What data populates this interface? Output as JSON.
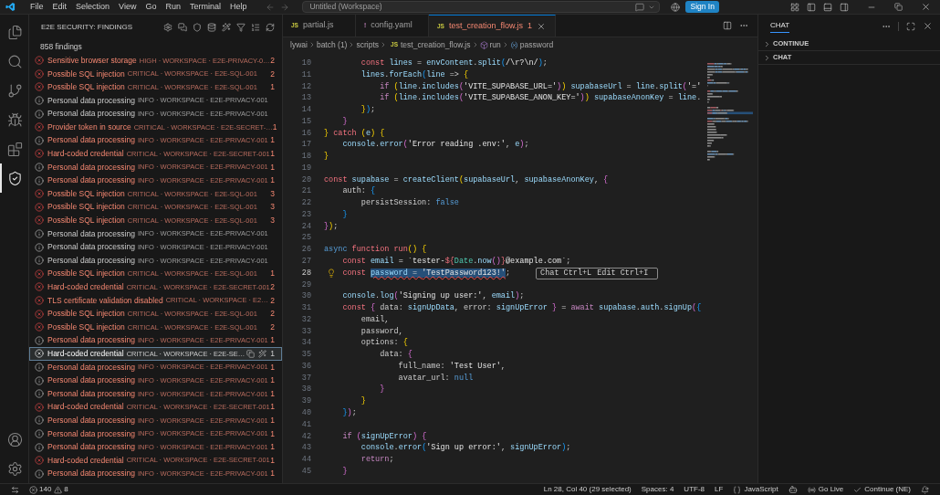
{
  "title_bar": {
    "menu": [
      "File",
      "Edit",
      "Selection",
      "View",
      "Go",
      "Run",
      "Terminal",
      "Help"
    ],
    "command_center": "Untitled (Workspace)",
    "sign_in": "Sign In"
  },
  "activity_bar": {
    "items": [
      {
        "kind": "files",
        "selected": false
      },
      {
        "kind": "search",
        "selected": false
      },
      {
        "kind": "branch",
        "selected": false
      },
      {
        "kind": "debug",
        "selected": false
      },
      {
        "kind": "extensions",
        "selected": false
      },
      {
        "kind": "security",
        "selected": true
      }
    ],
    "bottom_items": [
      {
        "kind": "account"
      },
      {
        "kind": "settings"
      }
    ]
  },
  "sidebar": {
    "title": "E2E SECURITY: FINDINGS",
    "summary": "858 findings",
    "findings": [
      {
        "kind": "error",
        "highlighted": true,
        "selected": false,
        "title": "Sensitive browser storage",
        "detail": "HIGH · WORKSPACE · E2E-PRIVACY-0…",
        "count": "2"
      },
      {
        "kind": "error",
        "highlighted": true,
        "selected": false,
        "title": "Possible SQL injection",
        "detail": "CRITICAL · WORKSPACE · E2E-SQL-001",
        "count": "2"
      },
      {
        "kind": "error",
        "highlighted": true,
        "selected": false,
        "title": "Possible SQL injection",
        "detail": "CRITICAL · WORKSPACE · E2E-SQL-001",
        "count": "1"
      },
      {
        "kind": "info",
        "highlighted": false,
        "selected": false,
        "title": "Personal data processing",
        "detail": "INFO · WORKSPACE · E2E-PRIVACY-001"
      },
      {
        "kind": "info",
        "highlighted": false,
        "selected": false,
        "title": "Personal data processing",
        "detail": "INFO · WORKSPACE · E2E-PRIVACY-001"
      },
      {
        "kind": "error",
        "highlighted": true,
        "selected": false,
        "title": "Provider token in source",
        "detail": "CRITICAL · WORKSPACE · E2E-SECRET-…",
        "count": "1"
      },
      {
        "kind": "info",
        "highlighted": true,
        "selected": false,
        "title": "Personal data processing",
        "detail": "INFO · WORKSPACE · E2E-PRIVACY-001",
        "count": "1"
      },
      {
        "kind": "error",
        "highlighted": true,
        "selected": false,
        "title": "Hard-coded credential",
        "detail": "CRITICAL · WORKSPACE · E2E-SECRET-001",
        "count": "1"
      },
      {
        "kind": "info",
        "highlighted": true,
        "selected": false,
        "title": "Personal data processing",
        "detail": "INFO · WORKSPACE · E2E-PRIVACY-001",
        "count": "1"
      },
      {
        "kind": "info",
        "highlighted": true,
        "selected": false,
        "title": "Personal data processing",
        "detail": "INFO · WORKSPACE · E2E-PRIVACY-001",
        "count": "1"
      },
      {
        "kind": "error",
        "highlighted": true,
        "selected": false,
        "title": "Possible SQL injection",
        "detail": "CRITICAL · WORKSPACE · E2E-SQL-001",
        "count": "3"
      },
      {
        "kind": "error",
        "highlighted": true,
        "selected": false,
        "title": "Possible SQL injection",
        "detail": "CRITICAL · WORKSPACE · E2E-SQL-001",
        "count": "3"
      },
      {
        "kind": "error",
        "highlighted": true,
        "selected": false,
        "title": "Possible SQL injection",
        "detail": "CRITICAL · WORKSPACE · E2E-SQL-001",
        "count": "3"
      },
      {
        "kind": "info",
        "highlighted": false,
        "selected": false,
        "title": "Personal data processing",
        "detail": "INFO · WORKSPACE · E2E-PRIVACY-001"
      },
      {
        "kind": "info",
        "highlighted": false,
        "selected": false,
        "title": "Personal data processing",
        "detail": "INFO · WORKSPACE · E2E-PRIVACY-001"
      },
      {
        "kind": "info",
        "highlighted": false,
        "selected": false,
        "title": "Personal data processing",
        "detail": "INFO · WORKSPACE · E2E-PRIVACY-001"
      },
      {
        "kind": "error",
        "highlighted": true,
        "selected": false,
        "title": "Possible SQL injection",
        "detail": "CRITICAL · WORKSPACE · E2E-SQL-001",
        "count": "1"
      },
      {
        "kind": "error",
        "highlighted": true,
        "selected": false,
        "title": "Hard-coded credential",
        "detail": "CRITICAL · WORKSPACE · E2E-SECRET-001",
        "count": "2"
      },
      {
        "kind": "error",
        "highlighted": true,
        "selected": false,
        "title": "TLS certificate validation disabled",
        "detail": "CRITICAL · WORKSPACE · E2…",
        "count": "2"
      },
      {
        "kind": "error",
        "highlighted": true,
        "selected": false,
        "title": "Possible SQL injection",
        "detail": "CRITICAL · WORKSPACE · E2E-SQL-001",
        "count": "2"
      },
      {
        "kind": "error",
        "highlighted": true,
        "selected": false,
        "title": "Possible SQL injection",
        "detail": "CRITICAL · WORKSPACE · E2E-SQL-001",
        "count": "2"
      },
      {
        "kind": "info",
        "highlighted": true,
        "selected": false,
        "title": "Personal data processing",
        "detail": "INFO · WORKSPACE · E2E-PRIVACY-001",
        "count": "1"
      },
      {
        "kind": "error",
        "highlighted": true,
        "selected": true,
        "title": "Hard-coded credential",
        "detail": "CRITICAL · WORKSPACE · E2E-SE…",
        "count": "1"
      },
      {
        "kind": "info",
        "highlighted": true,
        "selected": false,
        "title": "Personal data processing",
        "detail": "INFO · WORKSPACE · E2E-PRIVACY-001",
        "count": "1"
      },
      {
        "kind": "info",
        "highlighted": true,
        "selected": false,
        "title": "Personal data processing",
        "detail": "INFO · WORKSPACE · E2E-PRIVACY-001",
        "count": "1"
      },
      {
        "kind": "info",
        "highlighted": true,
        "selected": false,
        "title": "Personal data processing",
        "detail": "INFO · WORKSPACE · E2E-PRIVACY-001",
        "count": "1"
      },
      {
        "kind": "error",
        "highlighted": true,
        "selected": false,
        "title": "Hard-coded credential",
        "detail": "CRITICAL · WORKSPACE · E2E-SECRET-001",
        "count": "1"
      },
      {
        "kind": "info",
        "highlighted": true,
        "selected": false,
        "title": "Personal data processing",
        "detail": "INFO · WORKSPACE · E2E-PRIVACY-001",
        "count": "1"
      },
      {
        "kind": "info",
        "highlighted": true,
        "selected": false,
        "title": "Personal data processing",
        "detail": "INFO · WORKSPACE · E2E-PRIVACY-001",
        "count": "1"
      },
      {
        "kind": "info",
        "highlighted": true,
        "selected": false,
        "title": "Personal data processing",
        "detail": "INFO · WORKSPACE · E2E-PRIVACY-001",
        "count": "1"
      },
      {
        "kind": "error",
        "highlighted": true,
        "selected": false,
        "title": "Hard-coded credential",
        "detail": "CRITICAL · WORKSPACE · E2E-SECRET-001",
        "count": "1"
      },
      {
        "kind": "info",
        "highlighted": true,
        "selected": false,
        "title": "Personal data processing",
        "detail": "INFO · WORKSPACE · E2E-PRIVACY-001",
        "count": "1"
      }
    ]
  },
  "editor": {
    "tabs": [
      {
        "kind": "js",
        "icon": "JS",
        "label": "partial.js",
        "selected": false
      },
      {
        "kind": "yaml",
        "icon": "!",
        "label": "config.yaml",
        "selected": false
      },
      {
        "kind": "js",
        "icon": "JS",
        "label": "test_creation_flow.js",
        "badge": "1",
        "selected": true
      }
    ],
    "breadcrumbs": [
      {
        "kind": "folder",
        "label": "lywai"
      },
      {
        "kind": "folder",
        "label": "batch (1)"
      },
      {
        "kind": "folder",
        "label": "scripts"
      },
      {
        "kind": "js",
        "icon": "JS",
        "label": "test_creation_flow.js"
      },
      {
        "kind": "function",
        "label": "run"
      },
      {
        "kind": "variable",
        "label": "password"
      }
    ],
    "lines": [
      {
        "number": "10",
        "current": false,
        "tokens": [
          {
            "text": "        const ",
            "kind": "kw"
          },
          {
            "text": "lines",
            "kind": "id"
          },
          {
            "text": " = ",
            "kind": "txt"
          },
          {
            "text": "envContent",
            "kind": "id"
          },
          {
            "text": ".",
            "kind": "txt"
          },
          {
            "text": "split",
            "kind": "id"
          },
          {
            "text": "(",
            "kind": "b3"
          },
          {
            "text": "/\\r?\\n/",
            "kind": "str"
          },
          {
            "text": ")",
            "kind": "b3"
          },
          {
            "text": ";",
            "kind": "txt"
          }
        ]
      },
      {
        "number": "11",
        "current": false,
        "tokens": [
          {
            "text": "        lines",
            "kind": "id"
          },
          {
            "text": ".",
            "kind": "txt"
          },
          {
            "text": "forEach",
            "kind": "id"
          },
          {
            "text": "(",
            "kind": "b3"
          },
          {
            "text": "line",
            "kind": "id"
          },
          {
            "text": " => ",
            "kind": "txt"
          },
          {
            "text": "{",
            "kind": "b1"
          }
        ]
      },
      {
        "number": "12",
        "current": false,
        "tokens": [
          {
            "text": "            if ",
            "kind": "ctl"
          },
          {
            "text": "(",
            "kind": "b1"
          },
          {
            "text": "line",
            "kind": "id"
          },
          {
            "text": ".",
            "kind": "txt"
          },
          {
            "text": "includes",
            "kind": "id"
          },
          {
            "text": "(",
            "kind": "b2"
          },
          {
            "text": "'VITE_SUPABASE_URL='",
            "kind": "str"
          },
          {
            "text": ")",
            "kind": "b2"
          },
          {
            "text": ") ",
            "kind": "b1"
          },
          {
            "text": "supabaseUrl",
            "kind": "id"
          },
          {
            "text": " = ",
            "kind": "txt"
          },
          {
            "text": "line",
            "kind": "id"
          },
          {
            "text": ".",
            "kind": "txt"
          },
          {
            "text": "split",
            "kind": "id"
          },
          {
            "text": "(",
            "kind": "b2"
          },
          {
            "text": "'='",
            "kind": "str"
          }
        ]
      },
      {
        "number": "13",
        "current": false,
        "tokens": [
          {
            "text": "            if ",
            "kind": "ctl"
          },
          {
            "text": "(",
            "kind": "b1"
          },
          {
            "text": "line",
            "kind": "id"
          },
          {
            "text": ".",
            "kind": "txt"
          },
          {
            "text": "includes",
            "kind": "id"
          },
          {
            "text": "(",
            "kind": "b2"
          },
          {
            "text": "'VITE_SUPABASE_ANON_KEY='",
            "kind": "str"
          },
          {
            "text": ")",
            "kind": "b2"
          },
          {
            "text": ") ",
            "kind": "b1"
          },
          {
            "text": "supabaseAnonKey",
            "kind": "id"
          },
          {
            "text": " = ",
            "kind": "txt"
          },
          {
            "text": "line",
            "kind": "id"
          },
          {
            "text": ".",
            "kind": "txt"
          }
        ]
      },
      {
        "number": "14",
        "current": false,
        "tokens": [
          {
            "text": "        }",
            "kind": "b1"
          },
          {
            "text": ")",
            "kind": "b3"
          },
          {
            "text": ";",
            "kind": "txt"
          }
        ]
      },
      {
        "number": "15",
        "current": false,
        "tokens": [
          {
            "text": "    }",
            "kind": "b2"
          }
        ]
      },
      {
        "number": "16",
        "current": false,
        "tokens": [
          {
            "text": "}",
            "kind": "b1"
          },
          {
            "text": " catch ",
            "kind": "kw"
          },
          {
            "text": "(",
            "kind": "b1"
          },
          {
            "text": "e",
            "kind": "id"
          },
          {
            "text": ") {",
            "kind": "b1"
          }
        ]
      },
      {
        "number": "17",
        "current": false,
        "tokens": [
          {
            "text": "    console",
            "kind": "id"
          },
          {
            "text": ".",
            "kind": "txt"
          },
          {
            "text": "error",
            "kind": "id"
          },
          {
            "text": "(",
            "kind": "b2"
          },
          {
            "text": "'Error reading .env:'",
            "kind": "str"
          },
          {
            "text": ", ",
            "kind": "txt"
          },
          {
            "text": "e",
            "kind": "id"
          },
          {
            "text": ")",
            "kind": "b2"
          },
          {
            "text": ";",
            "kind": "txt"
          }
        ]
      },
      {
        "number": "18",
        "current": false,
        "tokens": [
          {
            "text": "}",
            "kind": "b1"
          }
        ]
      },
      {
        "number": "19",
        "current": false
      },
      {
        "number": "20",
        "current": false,
        "tokens": [
          {
            "text": "const ",
            "kind": "kw"
          },
          {
            "text": "supabase",
            "kind": "id"
          },
          {
            "text": " = ",
            "kind": "txt"
          },
          {
            "text": "createClient",
            "kind": "id"
          },
          {
            "text": "(",
            "kind": "b1"
          },
          {
            "text": "supabaseUrl",
            "kind": "id"
          },
          {
            "text": ", ",
            "kind": "txt"
          },
          {
            "text": "supabaseAnonKey",
            "kind": "id"
          },
          {
            "text": ", ",
            "kind": "txt"
          },
          {
            "text": "{",
            "kind": "b2"
          }
        ]
      },
      {
        "number": "21",
        "current": false,
        "tokens": [
          {
            "text": "    auth: ",
            "kind": "txt"
          },
          {
            "text": "{",
            "kind": "b3"
          }
        ]
      },
      {
        "number": "22",
        "current": false,
        "tokens": [
          {
            "text": "        persistSession: ",
            "kind": "txt"
          },
          {
            "text": "false",
            "kind": "lit"
          }
        ]
      },
      {
        "number": "23",
        "current": false,
        "tokens": [
          {
            "text": "    }",
            "kind": "b3"
          }
        ]
      },
      {
        "number": "24",
        "current": false,
        "tokens": [
          {
            "text": "}",
            "kind": "b2"
          },
          {
            "text": ")",
            "kind": "b1"
          },
          {
            "text": ";",
            "kind": "txt"
          }
        ]
      },
      {
        "number": "25",
        "current": false
      },
      {
        "number": "26",
        "current": false,
        "tokens": [
          {
            "text": "async ",
            "kind": "lit"
          },
          {
            "text": "function run",
            "kind": "kw"
          },
          {
            "text": "() {",
            "kind": "b1"
          }
        ]
      },
      {
        "number": "27",
        "current": false,
        "tokens": [
          {
            "text": "    const ",
            "kind": "kw"
          },
          {
            "text": "email",
            "kind": "id"
          },
          {
            "text": " = `tester-",
            "kind": "str"
          },
          {
            "text": "${",
            "kind": "kw"
          },
          {
            "text": "Date",
            "kind": "cls"
          },
          {
            "text": ".",
            "kind": "txt"
          },
          {
            "text": "now",
            "kind": "id"
          },
          {
            "text": "()",
            "kind": "b2"
          },
          {
            "text": "}",
            "kind": "kw"
          },
          {
            "text": "@example.com`",
            "kind": "str"
          },
          {
            "text": ";",
            "kind": "txt"
          }
        ]
      },
      {
        "number": "28",
        "current": true,
        "tokens": [
          {
            "text": "    const ",
            "kind": "kw"
          }
        ],
        "selection": [
          {
            "text": "password",
            "kind": "id"
          },
          {
            "text": " = ",
            "kind": "txt"
          },
          {
            "text": "'TestPassword123!'",
            "kind": "str"
          }
        ],
        "after": [
          {
            "text": ";",
            "kind": "txt"
          }
        ],
        "hint": [
          {
            "label": "Chat",
            "key": "Ctrl+L"
          },
          {
            "label": "Edit",
            "key": "Ctrl+I"
          }
        ]
      },
      {
        "number": "29",
        "current": false
      },
      {
        "number": "30",
        "current": false,
        "tokens": [
          {
            "text": "    console",
            "kind": "id"
          },
          {
            "text": ".",
            "kind": "txt"
          },
          {
            "text": "log",
            "kind": "id"
          },
          {
            "text": "(",
            "kind": "b2"
          },
          {
            "text": "'Signing up user:'",
            "kind": "str"
          },
          {
            "text": ", ",
            "kind": "txt"
          },
          {
            "text": "email",
            "kind": "id"
          },
          {
            "text": ")",
            "kind": "b2"
          },
          {
            "text": ";",
            "kind": "txt"
          }
        ]
      },
      {
        "number": "31",
        "current": false,
        "tokens": [
          {
            "text": "    const ",
            "kind": "kw"
          },
          {
            "text": "{",
            "kind": "b2"
          },
          {
            "text": " data: ",
            "kind": "txt"
          },
          {
            "text": "signUpData",
            "kind": "id"
          },
          {
            "text": ", error: ",
            "kind": "txt"
          },
          {
            "text": "signUpError ",
            "kind": "id"
          },
          {
            "text": "}",
            "kind": "b2"
          },
          {
            "text": " = ",
            "kind": "txt"
          },
          {
            "text": "await ",
            "kind": "ctl"
          },
          {
            "text": "supabase",
            "kind": "id"
          },
          {
            "text": ".",
            "kind": "txt"
          },
          {
            "text": "auth",
            "kind": "id"
          },
          {
            "text": ".",
            "kind": "txt"
          },
          {
            "text": "signUp",
            "kind": "id"
          },
          {
            "text": "(",
            "kind": "b2"
          },
          {
            "text": "{",
            "kind": "b3"
          }
        ]
      },
      {
        "number": "32",
        "current": false,
        "tokens": [
          {
            "text": "        email,",
            "kind": "txt"
          }
        ]
      },
      {
        "number": "33",
        "current": false,
        "tokens": [
          {
            "text": "        password,",
            "kind": "txt"
          }
        ]
      },
      {
        "number": "34",
        "current": false,
        "tokens": [
          {
            "text": "        options: ",
            "kind": "txt"
          },
          {
            "text": "{",
            "kind": "b1"
          }
        ]
      },
      {
        "number": "35",
        "current": false,
        "tokens": [
          {
            "text": "            data: ",
            "kind": "txt"
          },
          {
            "text": "{",
            "kind": "b2"
          }
        ]
      },
      {
        "number": "36",
        "current": false,
        "tokens": [
          {
            "text": "                full_name: ",
            "kind": "txt"
          },
          {
            "text": "'Test User'",
            "kind": "str"
          },
          {
            "text": ",",
            "kind": "txt"
          }
        ]
      },
      {
        "number": "37",
        "current": false,
        "tokens": [
          {
            "text": "                avatar_url: ",
            "kind": "txt"
          },
          {
            "text": "null",
            "kind": "lit"
          }
        ]
      },
      {
        "number": "38",
        "current": false,
        "tokens": [
          {
            "text": "            }",
            "kind": "b2"
          }
        ]
      },
      {
        "number": "39",
        "current": false,
        "tokens": [
          {
            "text": "        }",
            "kind": "b1"
          }
        ]
      },
      {
        "number": "40",
        "current": false,
        "tokens": [
          {
            "text": "    }",
            "kind": "b3"
          },
          {
            "text": ")",
            "kind": "b2"
          },
          {
            "text": ";",
            "kind": "txt"
          }
        ]
      },
      {
        "number": "41",
        "current": false
      },
      {
        "number": "42",
        "current": false,
        "tokens": [
          {
            "text": "    if ",
            "kind": "ctl"
          },
          {
            "text": "(",
            "kind": "b2"
          },
          {
            "text": "signUpError",
            "kind": "id"
          },
          {
            "text": ") {",
            "kind": "b2"
          }
        ]
      },
      {
        "number": "43",
        "current": false,
        "tokens": [
          {
            "text": "        console",
            "kind": "id"
          },
          {
            "text": ".",
            "kind": "txt"
          },
          {
            "text": "error",
            "kind": "id"
          },
          {
            "text": "(",
            "kind": "b3"
          },
          {
            "text": "'Sign up error:'",
            "kind": "str"
          },
          {
            "text": ", ",
            "kind": "txt"
          },
          {
            "text": "signUpError",
            "kind": "id"
          },
          {
            "text": ")",
            "kind": "b3"
          },
          {
            "text": ";",
            "kind": "txt"
          }
        ]
      },
      {
        "number": "44",
        "current": false,
        "tokens": [
          {
            "text": "        return",
            "kind": "ctl"
          },
          {
            "text": ";",
            "kind": "txt"
          }
        ]
      },
      {
        "number": "45",
        "current": false,
        "tokens": [
          {
            "text": "    }",
            "kind": "b2"
          }
        ]
      }
    ]
  },
  "chat_panel": {
    "tab": "CHAT",
    "sections": [
      {
        "label": "CONTINUE",
        "expanded": false
      },
      {
        "label": "CHAT",
        "expanded": false
      }
    ]
  },
  "status_bar": {
    "errors": "140",
    "warnings": "8",
    "cursor": "Ln 28, Col 40 (29 selected)",
    "indentation": "Spaces: 4",
    "encoding": "UTF-8",
    "line_ending": "LF",
    "language": "JavaScript",
    "live_server": "Go Live",
    "continue": "Continue (NE)"
  }
}
